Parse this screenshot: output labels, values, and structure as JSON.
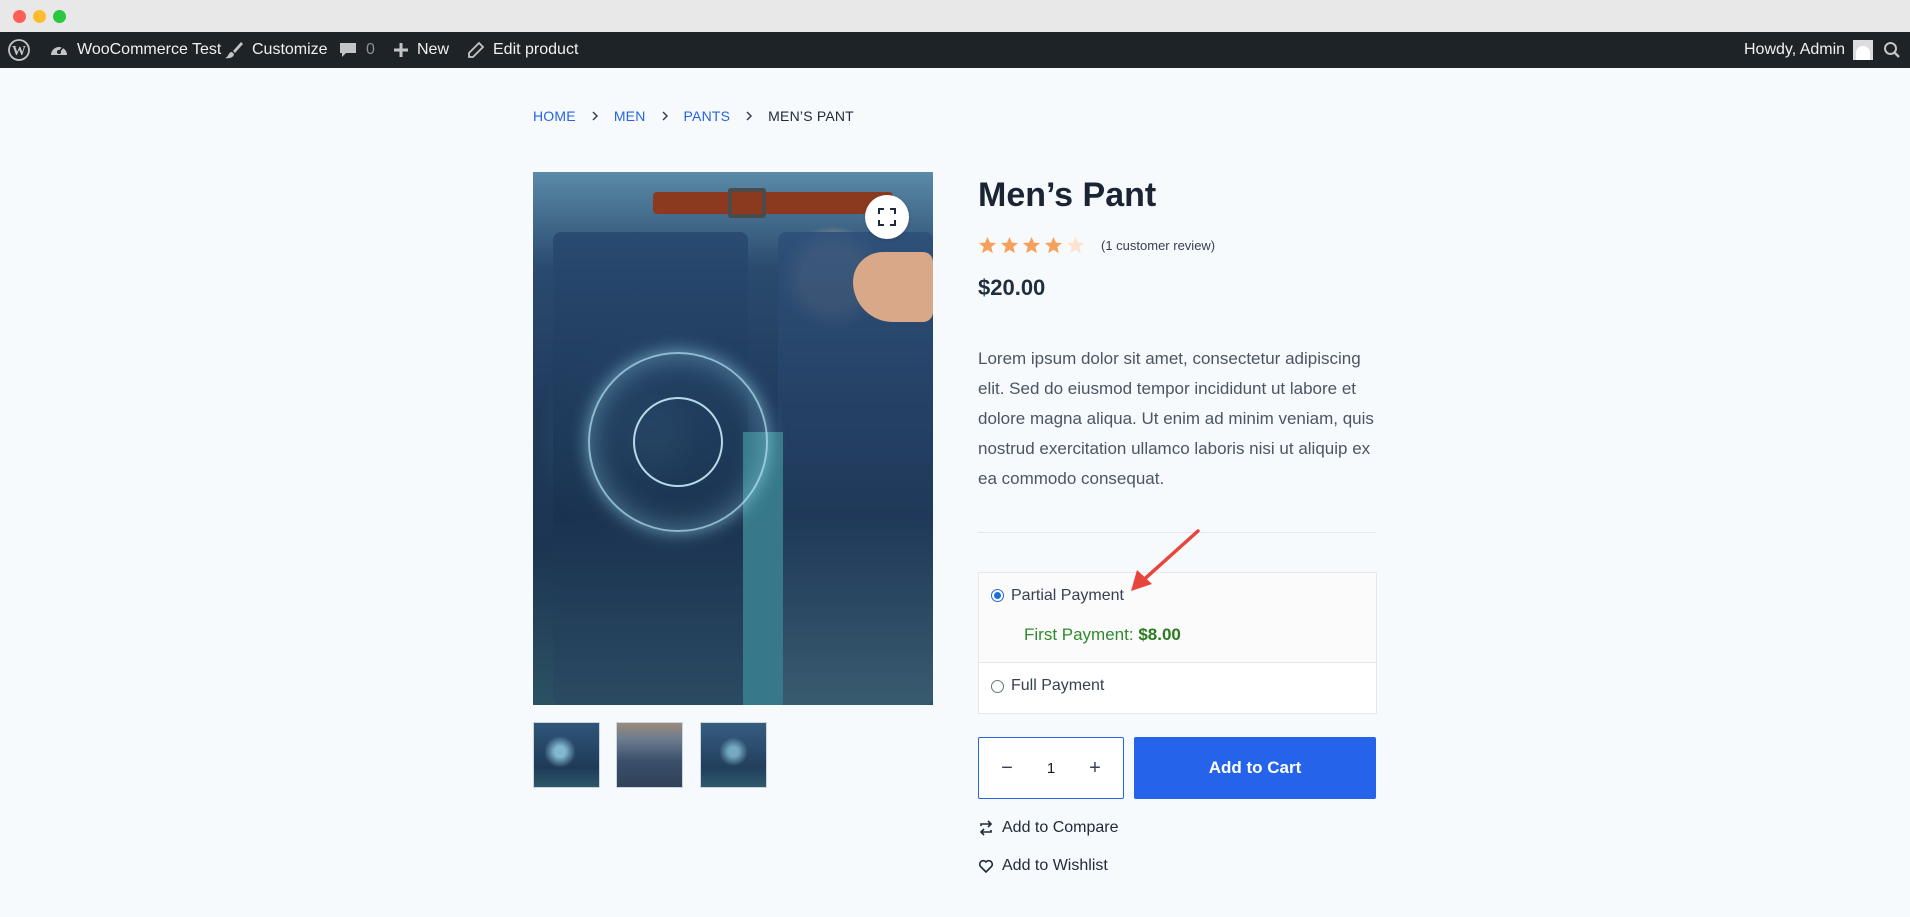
{
  "adminbar": {
    "site_name": "WooCommerce Test",
    "customize": "Customize",
    "comments_count": "0",
    "new": "New",
    "edit_product": "Edit product",
    "howdy": "Howdy, Admin"
  },
  "breadcrumb": {
    "items": [
      "HOME",
      "MEN",
      "PANTS",
      "MEN’S PANT"
    ]
  },
  "product": {
    "title": "Men’s Pant",
    "rating": 4,
    "rating_max": 5,
    "review_link": "(1 customer review)",
    "price": "$20.00",
    "description": "Lorem ipsum dolor sit amet, consectetur adipiscing elit. Sed do eiusmod tempor incididunt ut labore et dolore magna aliqua. Ut enim ad minim veniam, quis nostrud exercitation ullamco laboris nisi ut aliquip ex ea commodo consequat."
  },
  "payment": {
    "partial_label": "Partial Payment",
    "partial_selected": true,
    "first_payment_label": "First Payment:",
    "first_payment_amount": "$8.00",
    "full_label": "Full Payment",
    "full_selected": false
  },
  "cart": {
    "quantity": "1",
    "minus": "−",
    "plus": "+",
    "add_to_cart": "Add to Cart"
  },
  "links": {
    "compare": "Add to Compare",
    "wishlist": "Add to Wishlist"
  },
  "colors": {
    "accent": "#2563eb",
    "star": "#f5a05b",
    "star_empty": "#fde2d0",
    "success": "#2f8a2f",
    "annotation_arrow": "#e8453c"
  },
  "icons": {
    "wordpress": "wordpress-logo-icon",
    "dashboard": "dashboard-gauge-icon",
    "customize": "paintbrush-icon",
    "comments": "comment-bubble-icon",
    "new": "plus-icon",
    "edit": "pencil-icon",
    "search": "search-icon",
    "zoom": "fullscreen-icon",
    "compare": "compare-arrows-icon",
    "wishlist": "heart-icon"
  }
}
